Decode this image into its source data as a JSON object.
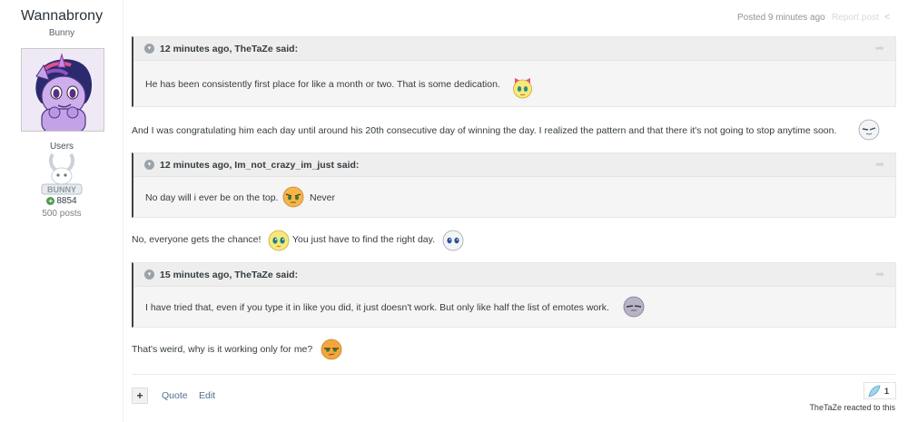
{
  "author": {
    "name": "Wannabrony",
    "title": "Bunny",
    "group": "Users",
    "group_badge_text": "BUNNY",
    "reputation": "8854",
    "posts": "500 posts"
  },
  "post_meta": {
    "posted": "Posted 9 minutes ago",
    "report": "Report post"
  },
  "quotes": [
    {
      "header": "12 minutes ago, TheTaZe said:",
      "text": "He has been consistently first place for like a month or two. That is some dedication."
    },
    {
      "header": "12 minutes ago, Im_not_crazy_im_just said:",
      "text": "No day will i ever be on the top.",
      "text_after": "Never"
    },
    {
      "header": "15 minutes ago, TheTaZe said:",
      "text": "I have tried that, even if you type it in like you did, it just doesn't work. But only like half the list of emotes work."
    }
  ],
  "paragraphs": [
    {
      "text": "And I was congratulating him each day until around his 20th consecutive day of winning the day. I realized the pattern and that there it's not going to stop anytime soon."
    },
    {
      "text": "No, everyone gets the chance!",
      "text_after": "You just have to find the right day."
    },
    {
      "text": "That's weird, why is it working only for me?"
    }
  ],
  "actions": {
    "plus": "+",
    "quote": "Quote",
    "edit": "Edit"
  },
  "reactions": {
    "count": "1",
    "summary": "TheTaZe reacted to this"
  },
  "colors": {
    "link": "#4f6f95",
    "quote_border": "#3d4246",
    "reputation_positive": "#4e9a4c"
  }
}
